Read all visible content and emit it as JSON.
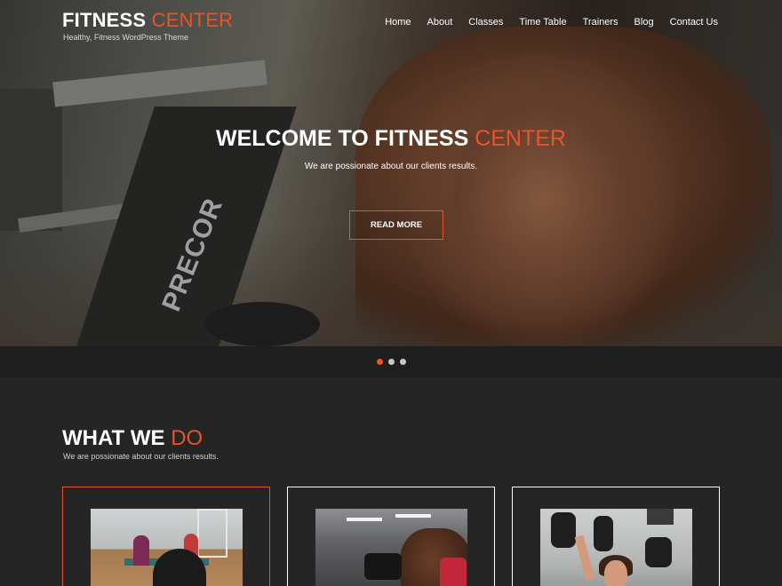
{
  "header": {
    "logo_main": "FITNESS",
    "logo_accent": "CENTER",
    "tagline": "Healthy, Fitness WordPress Theme",
    "nav": [
      "Home",
      "About",
      "Classes",
      "Time Table",
      "Trainers",
      "Blog",
      "Contact Us"
    ]
  },
  "hero": {
    "title_main": "WELCOME TO FITNESS",
    "title_accent": "CENTER",
    "subtitle": "We are possionate about our clients results.",
    "button_label": "READ MORE",
    "image_text": "PRECOR"
  },
  "slider": {
    "slide_count": 3,
    "active_index": 0
  },
  "what_we_do": {
    "title_main": "WHAT WE",
    "title_accent": "DO",
    "subtitle": "We are possionate about our clients results.",
    "cards": [
      {
        "image": "yoga-class-photo",
        "active": true
      },
      {
        "image": "dumbbell-curl-photo",
        "active": false
      },
      {
        "image": "woman-dumbbell-press-photo",
        "active": false
      }
    ]
  },
  "colors": {
    "accent": "#e8542a",
    "background": "#252525",
    "dots_bar": "#1e1e1e",
    "text": "#ffffff"
  }
}
